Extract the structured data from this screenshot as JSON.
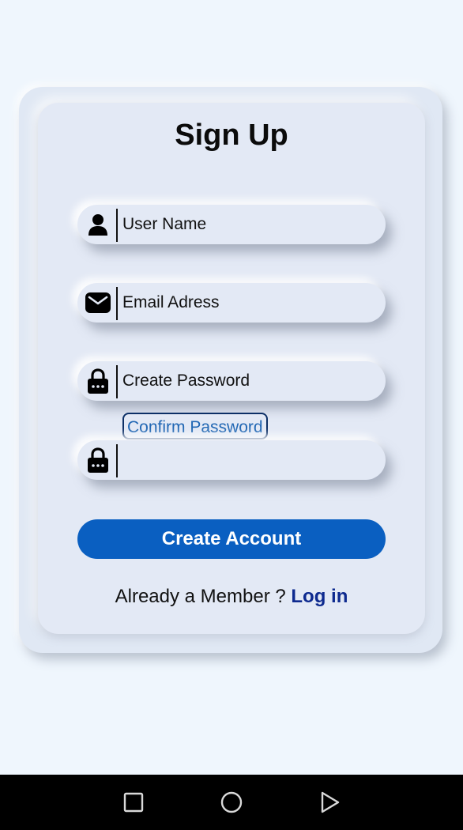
{
  "form": {
    "title": "Sign Up",
    "username_placeholder": "User Name",
    "email_placeholder": "Email Adress",
    "password_placeholder": "Create Password",
    "confirm_label": "Confirm Password",
    "confirm_value": "",
    "submit_label": "Create Account",
    "member_prompt": "Already a Member ? ",
    "login_link": "Log in"
  },
  "icons": {
    "username": "user-icon",
    "email": "envelope-icon",
    "password": "lock-icon",
    "confirm": "lock-icon"
  },
  "navbar": {
    "recents": "square-icon",
    "home": "circle-icon",
    "back": "triangle-back-icon"
  },
  "colors": {
    "background": "#eff6fd",
    "card": "#e3e9f5",
    "primary_button": "#0a5fc1",
    "login_link": "#0e2a8f",
    "confirm_label_text": "#2167b4",
    "navbar": "#000000"
  }
}
